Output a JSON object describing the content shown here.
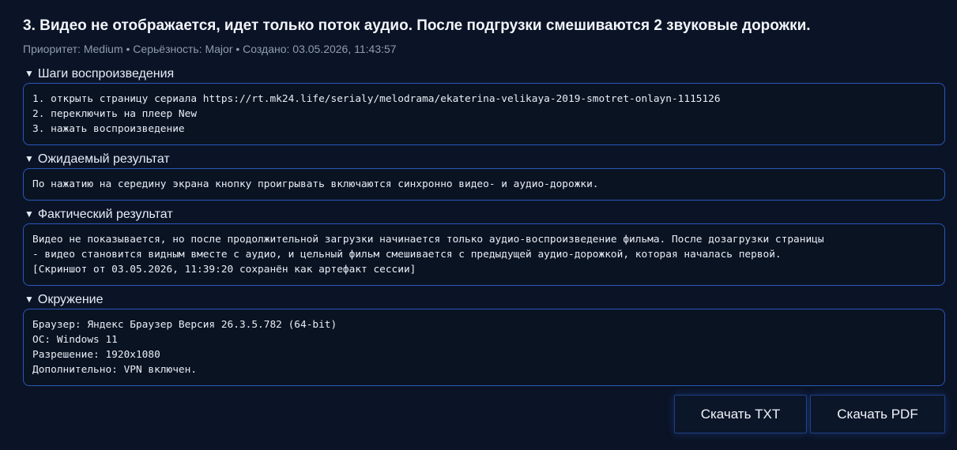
{
  "bug": {
    "title": "3. Видео не отображается, идет только поток аудио. После подгрузки смешиваются 2 звуковые дорожки.",
    "meta": "Приоритет: Medium • Серьёзность: Major • Создано: 03.05.2026, 11:43:57"
  },
  "sections": {
    "steps": {
      "heading": "Шаги воспроизведения",
      "lines": [
        "1. открыть страницу сериала https://rt.mk24.life/serialy/melodrama/ekaterina-velikaya-2019-smotret-onlayn-1115126",
        "2. переключить на плеер New",
        "3. нажать воспроизведение"
      ]
    },
    "expected": {
      "heading": "Ожидаемый результат",
      "lines": [
        "По нажатию на середину экрана кнопку проигрывать включаются синхронно видео- и аудио-дорожки."
      ]
    },
    "actual": {
      "heading": "Фактический результат",
      "lines": [
        "Видео не показывается, но после продолжительной загрузки начинается только аудио-воспроизведение фильма. После дозагрузки страницы",
        "- видео становится видным вместе с аудио, и цельный фильм смешивается с предыдущей аудио-дорожкой, которая началась первой.",
        "[Скриншот от 03.05.2026, 11:39:20 сохранён как артефакт сессии]"
      ]
    },
    "environment": {
      "heading": "Окружение",
      "lines": [
        "Браузер: Яндекс Браузер Версия 26.3.5.782 (64-bit)",
        "ОС: Windows 11",
        "Разрешение: 1920x1080",
        "Дополнительно: VPN включен."
      ]
    }
  },
  "toggle_glyph": "▼",
  "actions": {
    "download_txt": "Скачать TXT",
    "download_pdf": "Скачать PDF"
  },
  "colors": {
    "background": "#0b1426",
    "box_border": "#2a58b8",
    "muted_text": "#8f9bb0"
  }
}
